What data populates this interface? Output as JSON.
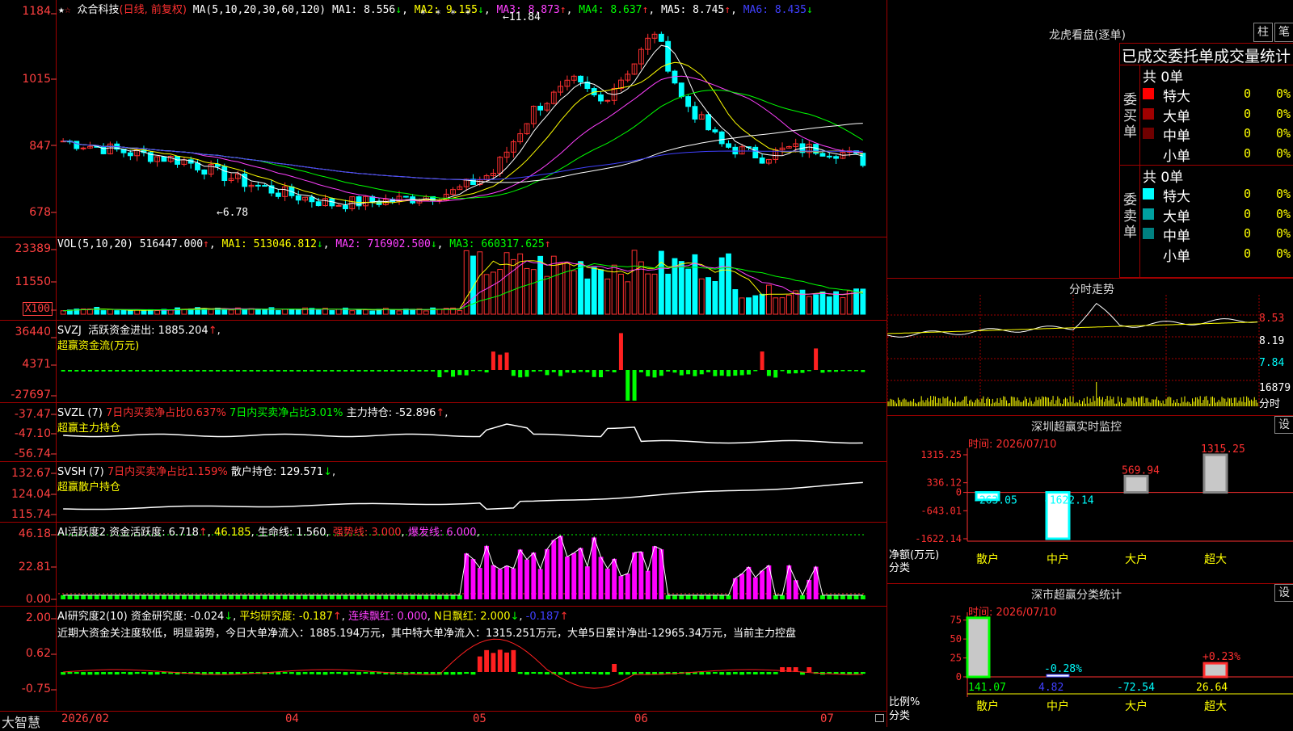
{
  "main_chart": {
    "stock_name": "众合科技",
    "period": "(日线, 前复权)",
    "ma_label": "MA(5,10,20,30,60,120)",
    "ma": [
      {
        "name": "MA1",
        "value": "8.556",
        "arrow": "↓",
        "color": "#ffffff"
      },
      {
        "name": "MA2",
        "value": "9.155",
        "arrow": "↓",
        "color": "#ffff00"
      },
      {
        "name": "MA3",
        "value": "8.873",
        "arrow": "↑",
        "color": "#ff40ff"
      },
      {
        "name": "MA4",
        "value": "8.637",
        "arrow": "↑",
        "color": "#00ff00"
      },
      {
        "name": "MA5",
        "value": "8.745",
        "arrow": "↑",
        "color": "#ffffff"
      },
      {
        "name": "MA6",
        "value": "8.435",
        "arrow": "↓",
        "color": "#4040ff"
      }
    ],
    "y_labels": [
      "1184",
      "1015",
      "847",
      "678"
    ],
    "high_marker": "11.84",
    "low_marker": "6.78",
    "stars": "* * * *"
  },
  "vol_panel": {
    "label": "VOL(5,10,20)",
    "value": "516447.000",
    "value_arrow": "↑",
    "ma": [
      {
        "name": "MA1",
        "value": "513046.812",
        "arrow": "↓",
        "color": "#ffff00"
      },
      {
        "name": "MA2",
        "value": "716902.500",
        "arrow": "↓",
        "color": "#ff40ff"
      },
      {
        "name": "MA3",
        "value": "660317.625",
        "arrow": "↑",
        "color": "#00ff00"
      }
    ],
    "y_labels": [
      "23389",
      "11550"
    ],
    "unit_box": "X100"
  },
  "svzj_panel": {
    "label": "SVZJ",
    "text": "活跃资金进出: 1885.204",
    "arrow": "↑",
    "sub": "超赢资金流(万元)",
    "y_labels": [
      "36440",
      "4371",
      "-27697"
    ]
  },
  "svzl_panel": {
    "label": "SVZL (7)",
    "t1": "7日内买卖净占比0.637%",
    "t2": "7日内买卖净占比3.01%",
    "t3": "主力持仓: -52.896",
    "arrow": "↑",
    "sub": "超赢主力持仓",
    "y_labels": [
      "-37.47",
      "-47.10",
      "-56.74"
    ]
  },
  "svsh_panel": {
    "label": "SVSH (7)",
    "t1": "7日内买卖净占比1.159%",
    "t2": "散户持仓: 129.571",
    "arrow": "↓",
    "sub": "超赢散户持仓",
    "y_labels": [
      "132.67",
      "124.04",
      "115.74"
    ]
  },
  "ai_active_panel": {
    "label": "AI活跃度2",
    "t1": "资金活跃度: 6.718",
    "t2": "46.185",
    "t3": "生命线: 1.560",
    "t4": "强势线: 3.000",
    "t5": "爆发线: 6.000",
    "y_labels": [
      "46.18",
      "22.81",
      "0.00"
    ]
  },
  "ai_research_panel": {
    "label": "AI研究度2(10)",
    "t1": "资金研究度: -0.024",
    "t2": "平均研究度: -0.187",
    "t3": "连续飘红: 0.000",
    "t4": "N日飘红: 2.000",
    "t5": "-0.187",
    "comment": "近期大资金关注度较低，明显弱势，今日大单净流入：1885.194万元，其中特大单净流入：1315.251万元，大单5日累计净出-12965.34万元，当前主力控盘",
    "y_labels": [
      "2.00",
      "0.62",
      "-0.75"
    ]
  },
  "x_axis": {
    "brand": "大智慧",
    "labels": [
      "2026/02",
      "04",
      "05",
      "06",
      "07"
    ]
  },
  "dragon_tiger": {
    "title": "龙虎看盘(逐单)",
    "btn_bar": "柱",
    "btn_pen": "笔",
    "subtitle": "已成交委托单成交量统计",
    "buy_label": "委买单",
    "sell_label": "委卖单",
    "buy_total": "共 0单",
    "sell_total": "共 0单",
    "buy_rows": [
      {
        "name": "特大",
        "count": "0",
        "pct": "0%",
        "color": "#ff0000"
      },
      {
        "name": "大单",
        "count": "0",
        "pct": "0%",
        "color": "#a00000"
      },
      {
        "name": "中单",
        "count": "0",
        "pct": "0%",
        "color": "#700000"
      },
      {
        "name": "小单",
        "count": "0",
        "pct": "0%",
        "color": "#000000"
      }
    ],
    "sell_rows": [
      {
        "name": "特大",
        "count": "0",
        "pct": "0%",
        "color": "#00ffff"
      },
      {
        "name": "大单",
        "count": "0",
        "pct": "0%",
        "color": "#00a0a0"
      },
      {
        "name": "中单",
        "count": "0",
        "pct": "0%",
        "color": "#008080"
      },
      {
        "name": "小单",
        "count": "0",
        "pct": "0%",
        "color": "#000000"
      }
    ]
  },
  "intraday": {
    "title": "分时走势",
    "prices": [
      "8.53",
      "8.19",
      "7.84"
    ],
    "vol": "16879",
    "vol_unit": "分时"
  },
  "sz_monitor": {
    "title": "深圳超赢实时监控",
    "btn": "设",
    "time": "时间: 2026/07/10",
    "y_labels": [
      "1315.25",
      "336.12",
      "0",
      "-643.01",
      "-1622.14"
    ],
    "axis_label1": "净额(万元)",
    "axis_label2": "分类",
    "categories": [
      "散户",
      "中户",
      "大户",
      "超大"
    ],
    "values": [
      -263.05,
      -1622.14,
      569.94,
      1315.25
    ],
    "value_labels": [
      "-263.05",
      "-1622.14",
      "569.94",
      "1315.25"
    ]
  },
  "sz_stats": {
    "title": "深市超赢分类统计",
    "btn": "设",
    "time": "时间: 2026/07/10",
    "y_labels": [
      "75",
      "50",
      "25",
      "0"
    ],
    "axis_label1": "比例%",
    "axis_label2": "分类",
    "categories": [
      "散户",
      "中户",
      "大户",
      "超大"
    ],
    "bottom_values": [
      "141.07",
      "4.82",
      "-72.54",
      "26.64"
    ],
    "bar_labels": [
      "-0.28%",
      "+0.23%"
    ]
  },
  "colors": {
    "up": "#ff3030",
    "down": "#00ffff",
    "grid": "#a00000",
    "axis_text": "#ff4040",
    "green": "#00ff00",
    "magenta": "#ff00ff",
    "yellow": "#ffff00"
  }
}
